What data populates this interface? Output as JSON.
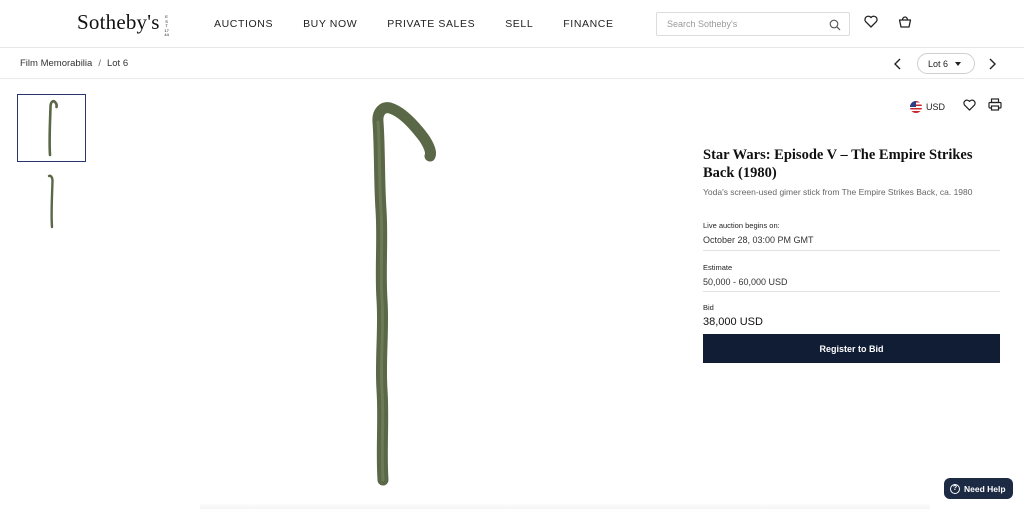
{
  "brand": {
    "name": "Sotheby's",
    "est": [
      "E",
      "S",
      "T",
      "17",
      "44"
    ]
  },
  "nav": {
    "items": [
      "AUCTIONS",
      "BUY NOW",
      "PRIVATE SALES",
      "SELL",
      "FINANCE"
    ]
  },
  "search": {
    "placeholder": "Search Sotheby's"
  },
  "icons": {
    "search": "search-icon",
    "favorite": "heart-icon",
    "bag": "shopping-bag-icon",
    "prev": "chevron-left-icon",
    "next": "chevron-right-icon",
    "print": "print-icon",
    "help": "question-icon"
  },
  "breadcrumb": {
    "category": "Film Memorabilia",
    "separator": "/",
    "current": "Lot 6"
  },
  "lot_selector": {
    "value": "Lot 6"
  },
  "currency": {
    "code": "USD"
  },
  "lot": {
    "title": "Star Wars: Episode V – The Empire Strikes Back (1980)",
    "subtitle": "Yoda's screen-used gimer stick from The Empire Strikes Back, ca. 1980",
    "auction_label": "Live auction begins on:",
    "auction_date": "October 28, 03:00 PM GMT",
    "estimate_label": "Estimate",
    "estimate_value": "50,000 - 60,000 USD",
    "bid_label": "Bid",
    "bid_value": "38,000 USD",
    "cta": "Register to Bid"
  },
  "help": {
    "label": "Need Help"
  },
  "colors": {
    "primary_button": "#111d34",
    "help_button": "#1c2a44",
    "active_thumb_border": "#2a3570",
    "stick": "#5a6847"
  }
}
